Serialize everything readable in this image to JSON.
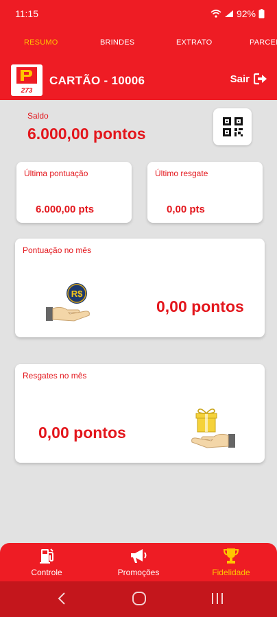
{
  "status_bar": {
    "time": "11:15",
    "battery": "92%"
  },
  "tabs": [
    {
      "label": "RESUMO",
      "active": true
    },
    {
      "label": "BRINDES",
      "active": false
    },
    {
      "label": "EXTRATO",
      "active": false
    },
    {
      "label": "PARCEI",
      "active": false
    }
  ],
  "header": {
    "logo_text": "273",
    "title": "CARTÃO - 10006",
    "logout_label": "Sair"
  },
  "saldo": {
    "label": "Saldo",
    "value": "6.000,00 pontos"
  },
  "ultima_pontuacao": {
    "label": "Última pontuação",
    "value": "6.000,00 pts"
  },
  "ultimo_resgate": {
    "label": "Último resgate",
    "value": "0,00 pts"
  },
  "pontuacao_mes": {
    "label": "Pontuação no mês",
    "value": "0,00 pontos",
    "coin_text": "R$"
  },
  "resgates_mes": {
    "label": "Resgates no mês",
    "value": "0,00 pontos"
  },
  "bottom_nav": [
    {
      "label": "Controle",
      "icon": "fuel-pump-icon",
      "active": false
    },
    {
      "label": "Promoções",
      "icon": "megaphone-icon",
      "active": false
    },
    {
      "label": "Fidelidade",
      "icon": "trophy-icon",
      "active": true
    }
  ],
  "colors": {
    "primary": "#ee1c24",
    "accent": "#ffc400",
    "text_red": "#e3161c",
    "background": "#e2e2e2"
  }
}
